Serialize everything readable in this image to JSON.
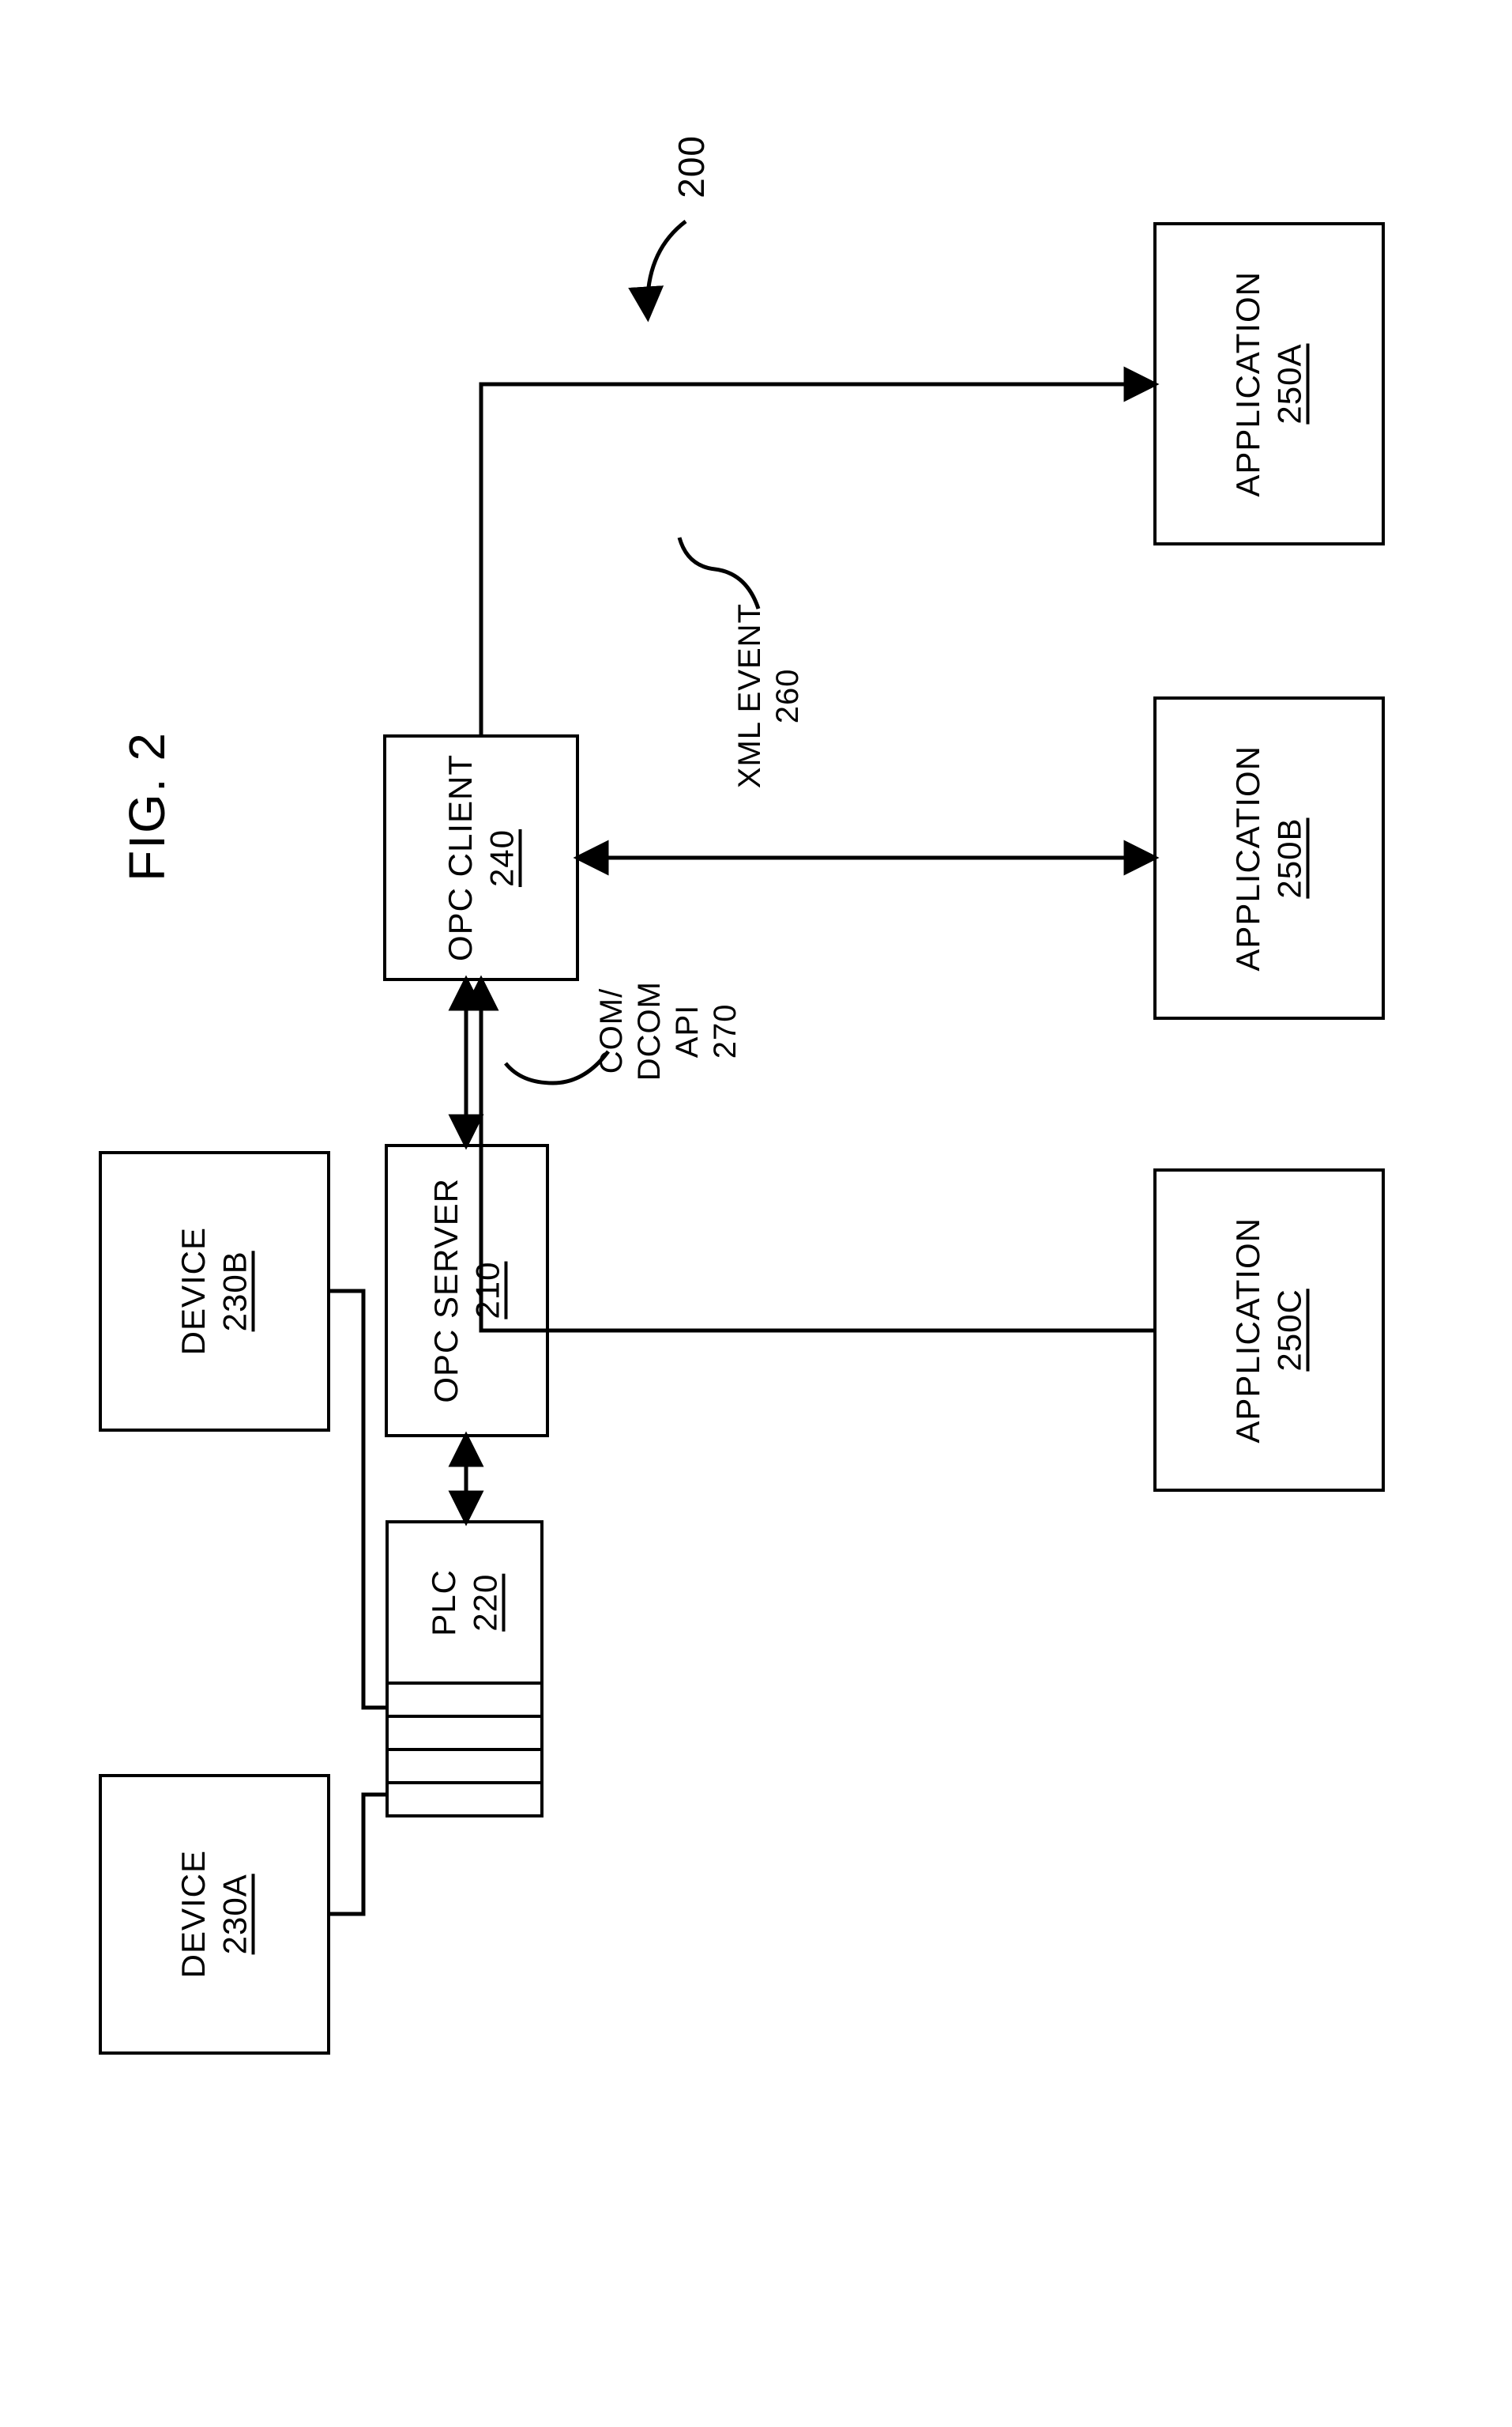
{
  "figure_ref": "200",
  "figure_label": "FIG. 2",
  "nodes": {
    "device_a": {
      "title": "DEVICE",
      "ref": "230A"
    },
    "device_b": {
      "title": "DEVICE",
      "ref": "230B"
    },
    "plc": {
      "title": "PLC",
      "ref": "220"
    },
    "opc_server": {
      "title": "OPC SERVER",
      "ref": "210"
    },
    "opc_client": {
      "title": "OPC CLIENT",
      "ref": "240"
    },
    "app_a": {
      "title": "APPLICATION",
      "ref": "250A"
    },
    "app_b": {
      "title": "APPLICATION",
      "ref": "250B"
    },
    "app_c": {
      "title": "APPLICATION",
      "ref": "250C"
    }
  },
  "labels": {
    "xml_event": {
      "line1": "XML EVENT",
      "ref": "260"
    },
    "com_api": {
      "line1": "COM/",
      "line2": "DCOM",
      "line3": "API",
      "ref": "270"
    }
  }
}
